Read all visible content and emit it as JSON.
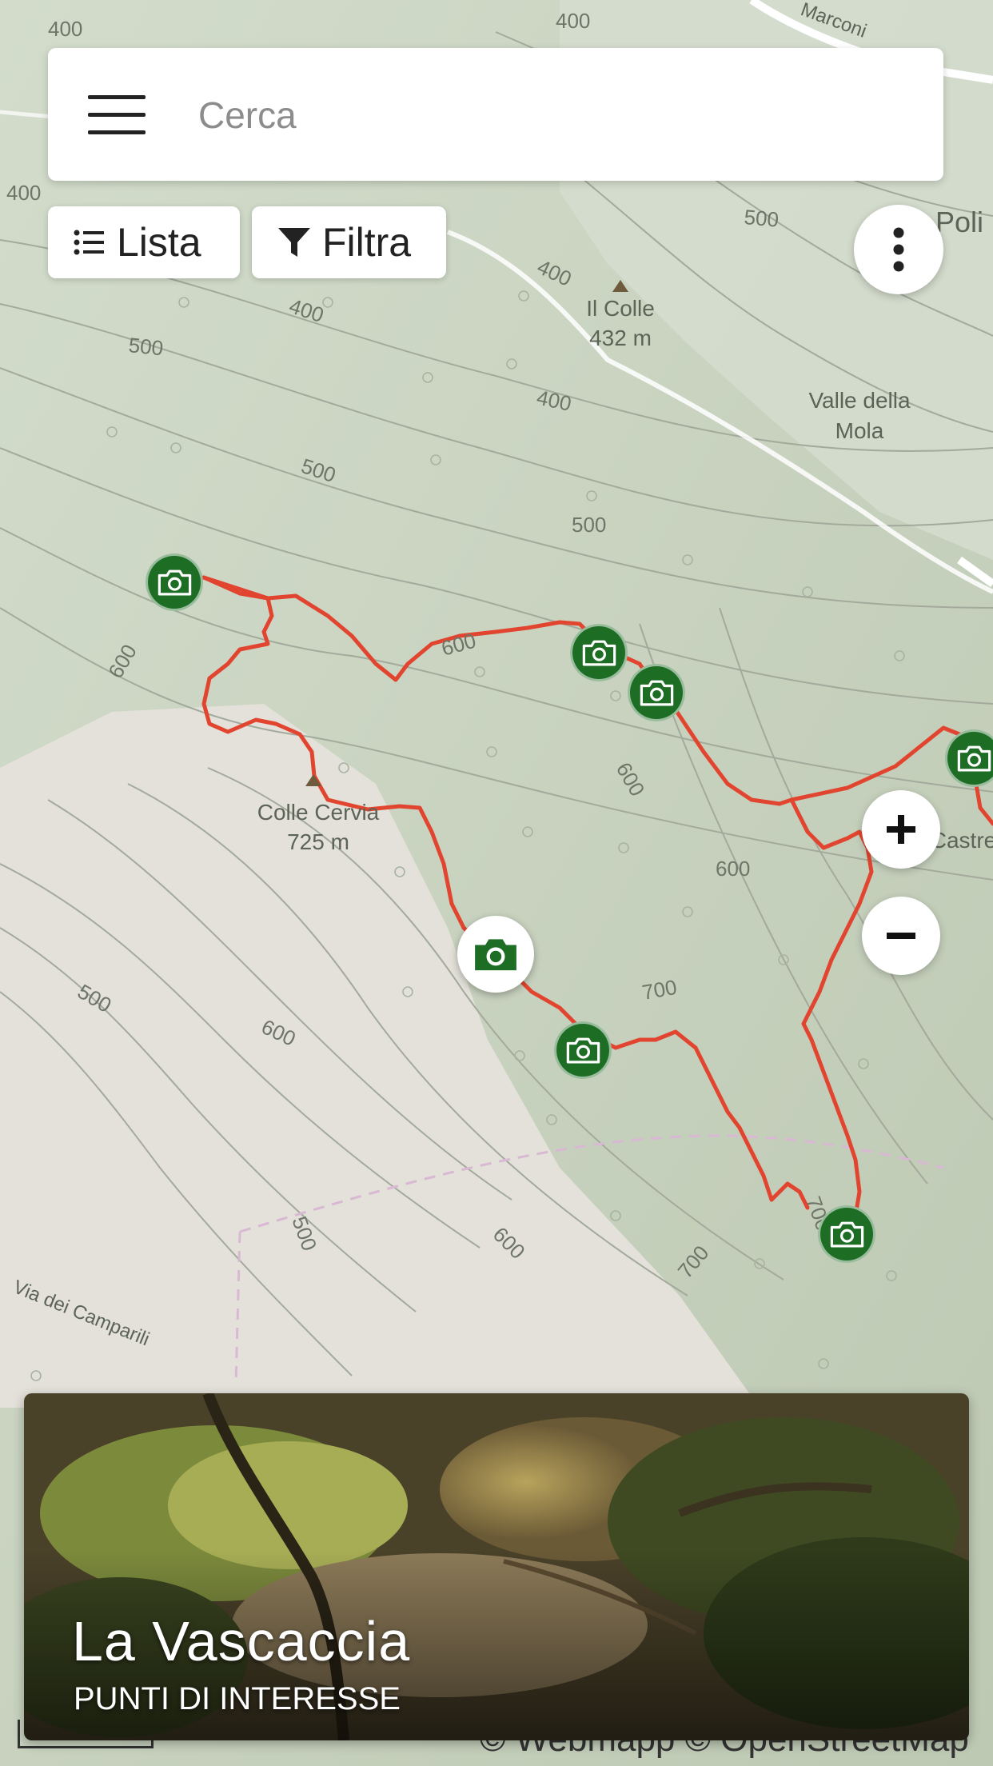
{
  "search": {
    "placeholder": "Cerca"
  },
  "toolbar": {
    "list_label": "Lista",
    "filter_label": "Filtra"
  },
  "icons": {
    "menu": "hamburger-menu-icon",
    "list": "list-icon",
    "filter": "filter-icon",
    "more": "more-vertical-icon",
    "zoom_in": "plus-icon",
    "zoom_out": "minus-icon",
    "poi": "camera-icon"
  },
  "map": {
    "colors": {
      "background": "#dfe3d6",
      "forest": "#c5d0bc",
      "bare_area": "#e3e1d9",
      "contour": "#9ea597",
      "track": "#e2452f",
      "river": "#ffffff",
      "poi_marker": "#1d6d25"
    },
    "peaks": [
      {
        "name": "Il Colle",
        "elevation": "432 m"
      },
      {
        "name": "Colle Cervia",
        "elevation": "725 m"
      }
    ],
    "place_labels": [
      "Valle della",
      "Mola",
      "Poli",
      "Via dei Camparili",
      "Marconi",
      "Castre"
    ],
    "contour_labels": [
      "400",
      "400",
      "400",
      "500",
      "500",
      "500",
      "500",
      "600",
      "600",
      "600",
      "600",
      "600",
      "700",
      "700",
      "700",
      "500",
      "500",
      "600",
      "400",
      "400",
      "400"
    ],
    "poi_count": 7
  },
  "attribution": "© Webmapp © OpenStreetMap",
  "card": {
    "title": "La Vascaccia",
    "subtitle": "PUNTI DI INTERESSE"
  }
}
